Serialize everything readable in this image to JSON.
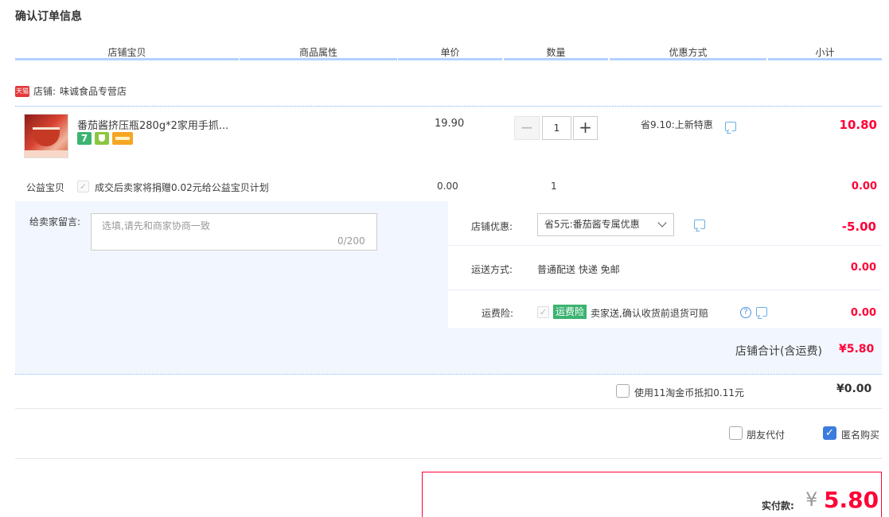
{
  "page_title": "确认订单信息",
  "columns": [
    "店铺宝贝",
    "商品属性",
    "单价",
    "数量",
    "优惠方式",
    "小计"
  ],
  "shop": {
    "label": "店铺:",
    "name": "味诚食品专营店",
    "logo_text": "天猫"
  },
  "item": {
    "title": "番茄酱挤压瓶280g*2家用手抓...",
    "badge_7": "7",
    "price": "19.90",
    "quantity": "1",
    "minus": "−",
    "plus": "+",
    "promo": "省9.10:上新特惠",
    "subtotal": "10.80"
  },
  "charity": {
    "label": "公益宝贝",
    "text": "成交后卖家将捐赠0.02元给公益宝贝计划",
    "price": "0.00",
    "quantity": "1",
    "subtotal": "0.00"
  },
  "memo": {
    "label": "给卖家留言:",
    "placeholder": "选填,请先和商家协商一致",
    "count": "0/200"
  },
  "shop_discount": {
    "label": "店铺优惠:",
    "selected": "省5元:番茄酱专属优惠",
    "value": "-5.00"
  },
  "shipping": {
    "label": "运送方式:",
    "method": "普通配送 快递 免邮",
    "value": "0.00"
  },
  "freight_insurance": {
    "label": "运费险:",
    "tag": "运费险",
    "text": "卖家送,确认收货前退货可赔",
    "value": "0.00"
  },
  "shop_total": {
    "label": "店铺合计(含运费)",
    "value": "¥5.80"
  },
  "coins": {
    "label": "使用11淘金币抵扣0.11元",
    "value": "¥0.00",
    "checked": false
  },
  "options": {
    "friend_pay": "朋友代付",
    "anonymous": "匿名购买",
    "anonymous_checked": true,
    "check_mark": "✓"
  },
  "payment": {
    "label": "实付款:",
    "currency": "¥",
    "value": "5.80"
  },
  "colors": {
    "accent_red": "#ff0036",
    "header_bar": "#b2d1ff",
    "light_bg": "#f2f7ff",
    "checkbox_blue": "#3b7ddd"
  }
}
